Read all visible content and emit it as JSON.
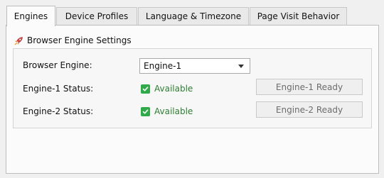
{
  "tabs": {
    "engines": "Engines",
    "device_profiles": "Device Profiles",
    "language_timezone": "Language & Timezone",
    "page_visit": "Page Visit Behavior",
    "active": "Engines"
  },
  "group": {
    "title": "Browser Engine Settings",
    "icon": "rocket-icon"
  },
  "engine": {
    "label": "Browser Engine:",
    "selected": "Engine-1"
  },
  "status": {
    "engine1_label": "Engine-1 Status:",
    "engine1_value": "Available",
    "engine1_button": "Engine-1 Ready",
    "engine2_label": "Engine-2 Status:",
    "engine2_value": "Available",
    "engine2_button": "Engine-2 Ready",
    "available_color": "#2e7d32",
    "check_color": "#2faa48"
  }
}
